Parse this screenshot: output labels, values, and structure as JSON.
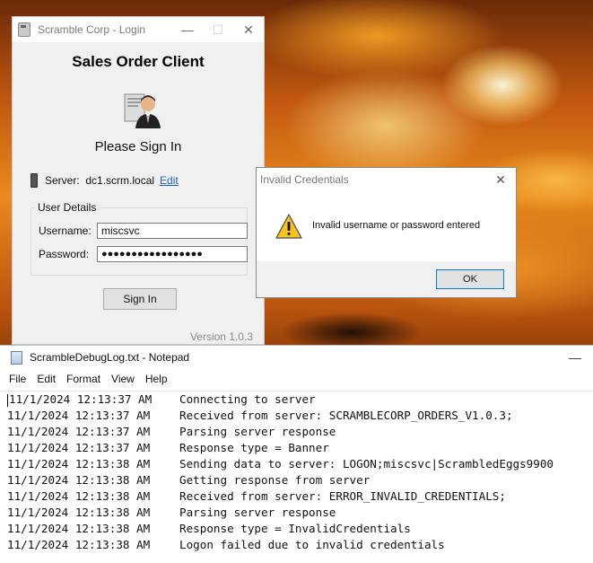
{
  "login_window": {
    "title": "Scramble Corp - Login",
    "heading": "Sales Order Client",
    "caption": "Please Sign In",
    "server_label": "Server:",
    "server_value": "dc1.scrm.local",
    "edit_link": "Edit",
    "group_label": "User Details",
    "username_label": "Username:",
    "username_value": "miscsvc",
    "password_label": "Password:",
    "password_masked": "●●●●●●●●●●●●●●●●●",
    "signin_button": "Sign In",
    "version": "Version 1.0.3",
    "icons": [
      "app-icon",
      "user-avatar-icon",
      "server-icon"
    ]
  },
  "error_dialog": {
    "title": "Invalid Credentials",
    "message": "Invalid username or password entered",
    "ok_button": "OK",
    "icons": [
      "warning-icon",
      "close-icon"
    ]
  },
  "notepad": {
    "title": "ScrambleDebugLog.txt - Notepad",
    "menu": [
      "File",
      "Edit",
      "Format",
      "View",
      "Help"
    ],
    "lines": [
      {
        "time": "11/1/2024 12:13:37 AM",
        "msg": "Connecting to server"
      },
      {
        "time": "11/1/2024 12:13:37 AM",
        "msg": "Received from server: SCRAMBLECORP_ORDERS_V1.0.3;"
      },
      {
        "time": "11/1/2024 12:13:37 AM",
        "msg": "Parsing server response"
      },
      {
        "time": "11/1/2024 12:13:37 AM",
        "msg": "Response type = Banner"
      },
      {
        "time": "11/1/2024 12:13:38 AM",
        "msg": "Sending data to server: LOGON;miscsvc|ScrambledEggs9900"
      },
      {
        "time": "11/1/2024 12:13:38 AM",
        "msg": "Getting response from server"
      },
      {
        "time": "11/1/2024 12:13:38 AM",
        "msg": "Received from server: ERROR_INVALID_CREDENTIALS;"
      },
      {
        "time": "11/1/2024 12:13:38 AM",
        "msg": "Parsing server response"
      },
      {
        "time": "11/1/2024 12:13:38 AM",
        "msg": "Response type = InvalidCredentials"
      },
      {
        "time": "11/1/2024 12:13:38 AM",
        "msg": "Logon failed due to invalid credentials"
      }
    ]
  },
  "colors": {
    "link": "#1a5fd0",
    "dialog_focus": "#0078d7",
    "warning": "#f7c21b"
  }
}
